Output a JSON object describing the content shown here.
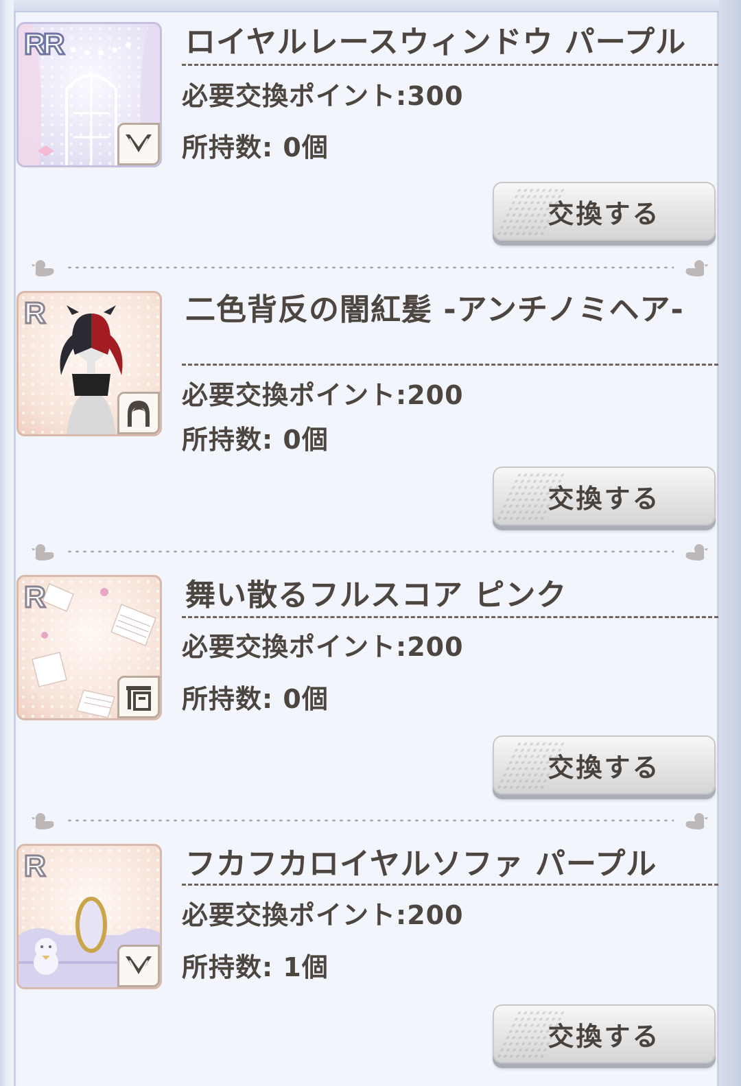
{
  "items": [
    {
      "rarity": "RR",
      "title": "ロイヤルレースウィンドウ パープル",
      "points": "必要交換ポイント:300",
      "owned": "所持数: 0個",
      "button": "交換する"
    },
    {
      "rarity": "R",
      "title": "二色背反の闇紅髪 -アンチノミヘア-",
      "points": "必要交換ポイント:200",
      "owned": "所持数: 0個",
      "button": "交換する"
    },
    {
      "rarity": "R",
      "title": "舞い散るフルスコア ピンク",
      "points": "必要交換ポイント:200",
      "owned": "所持数: 0個",
      "button": "交換する"
    },
    {
      "rarity": "R",
      "title": "フカフカロイヤルソファ パープル",
      "points": "必要交換ポイント:200",
      "owned": "所持数: 1個",
      "button": "交換する"
    }
  ],
  "icons": {
    "category_1": "wings-icon",
    "category_2": "hair-icon",
    "category_3": "furniture-icon",
    "category_4": "wings-icon",
    "divider_end": "duck-icon"
  },
  "colors": {
    "text": "#4d4540",
    "panel_bg": "#f2f5fb",
    "button_bg": "#e4e4e4"
  }
}
